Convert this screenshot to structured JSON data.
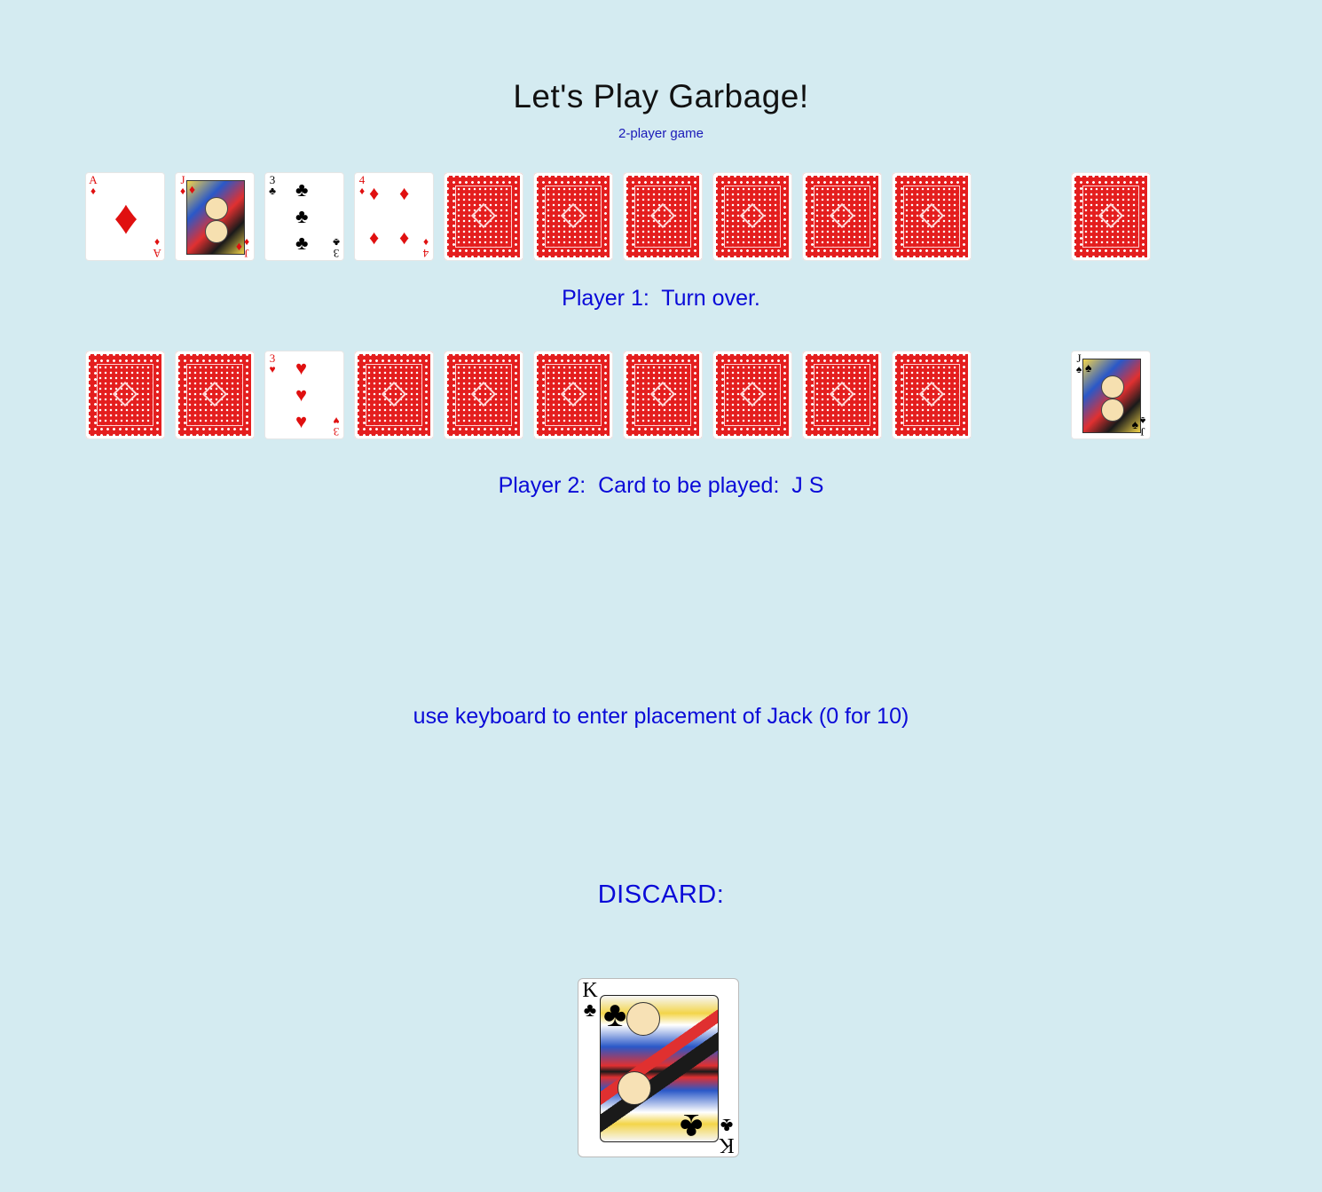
{
  "header": {
    "title": "Let's Play Garbage!",
    "subtitle": "2-player game"
  },
  "player1": {
    "status": "Player 1:  Turn over.",
    "cards": [
      {
        "state": "face",
        "rank": "A",
        "suit": "♦",
        "color": "red"
      },
      {
        "state": "face",
        "rank": "J",
        "suit": "♦",
        "color": "red"
      },
      {
        "state": "face",
        "rank": "3",
        "suit": "♣",
        "color": "black"
      },
      {
        "state": "face",
        "rank": "4",
        "suit": "♦",
        "color": "red"
      },
      {
        "state": "back"
      },
      {
        "state": "back"
      },
      {
        "state": "back"
      },
      {
        "state": "back"
      },
      {
        "state": "back"
      },
      {
        "state": "back"
      }
    ],
    "extra_card": {
      "state": "back"
    }
  },
  "player2": {
    "status": "Player 2:  Card to be played:  J S",
    "cards": [
      {
        "state": "back"
      },
      {
        "state": "back"
      },
      {
        "state": "face",
        "rank": "3",
        "suit": "♥",
        "color": "red"
      },
      {
        "state": "back"
      },
      {
        "state": "back"
      },
      {
        "state": "back"
      },
      {
        "state": "back"
      },
      {
        "state": "back"
      },
      {
        "state": "back"
      },
      {
        "state": "back"
      }
    ],
    "extra_card": {
      "state": "face",
      "rank": "J",
      "suit": "♠",
      "color": "black"
    }
  },
  "instruction": "use keyboard to enter placement of Jack (0 for 10)",
  "discard": {
    "label": "DISCARD:",
    "card": {
      "rank": "K",
      "suit": "♣",
      "color": "black"
    }
  },
  "colors": {
    "background": "#d4ebf1",
    "status_text": "#0a0ad8",
    "card_back": "#e41e1e"
  }
}
